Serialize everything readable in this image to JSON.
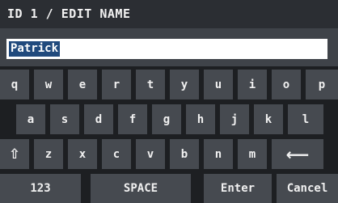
{
  "header": {
    "title": "ID 1 / EDIT NAME"
  },
  "input": {
    "value": "Patrick"
  },
  "keyboard": {
    "row1": [
      "q",
      "w",
      "e",
      "r",
      "t",
      "y",
      "u",
      "i",
      "o",
      "p"
    ],
    "row2": [
      "a",
      "s",
      "d",
      "f",
      "g",
      "h",
      "j",
      "k",
      "l"
    ],
    "row3": [
      "z",
      "x",
      "c",
      "v",
      "b",
      "n",
      "m"
    ],
    "shift_icon": "shift-up-arrow-icon",
    "backspace_icon": "left-arrow-icon",
    "bottom": {
      "numbers": "123",
      "space": "SPACE",
      "enter": "Enter",
      "cancel": "Cancel"
    }
  },
  "colors": {
    "header_bg": "#2b2e33",
    "key_bg": "#464a50",
    "selection": "#214a7d"
  }
}
